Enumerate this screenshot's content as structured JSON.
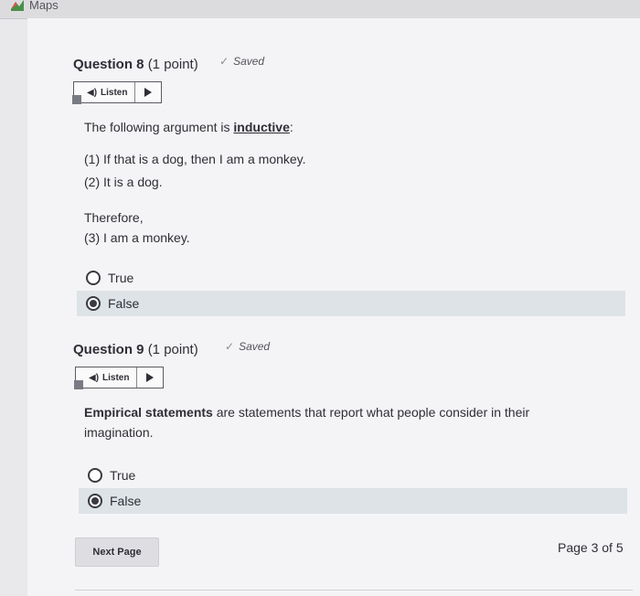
{
  "browser": {
    "bookmark_label": "Maps",
    "bookmark_icon": "maps-icon"
  },
  "question8": {
    "title_bold": "Question 8",
    "title_points": "(1 point)",
    "saved_label": "Saved",
    "listen_label": "Listen",
    "intro_prefix": "The following argument is ",
    "intro_keyword": "inductive",
    "intro_suffix": ":",
    "premise1": "(1) If that is a dog, then I am a monkey.",
    "premise2": "(2) It is a dog.",
    "therefore": "Therefore,",
    "conclusion": "(3) I am a monkey.",
    "options": [
      {
        "label": "True",
        "selected": false
      },
      {
        "label": "False",
        "selected": true
      }
    ]
  },
  "question9": {
    "title_bold": "Question 9",
    "title_points": "(1 point)",
    "saved_label": "Saved",
    "listen_label": "Listen",
    "statement_bold": "Empirical statements",
    "statement_rest1": " are statements that report what people consider in their",
    "statement_rest2": "imagination.",
    "options": [
      {
        "label": "True",
        "selected": false
      },
      {
        "label": "False",
        "selected": true
      }
    ]
  },
  "footer": {
    "next_label": "Next Page",
    "page_indicator": "Page 3 of 5"
  },
  "colors": {
    "selected_row": "#dde3e6",
    "background": "#f4f4f6"
  }
}
